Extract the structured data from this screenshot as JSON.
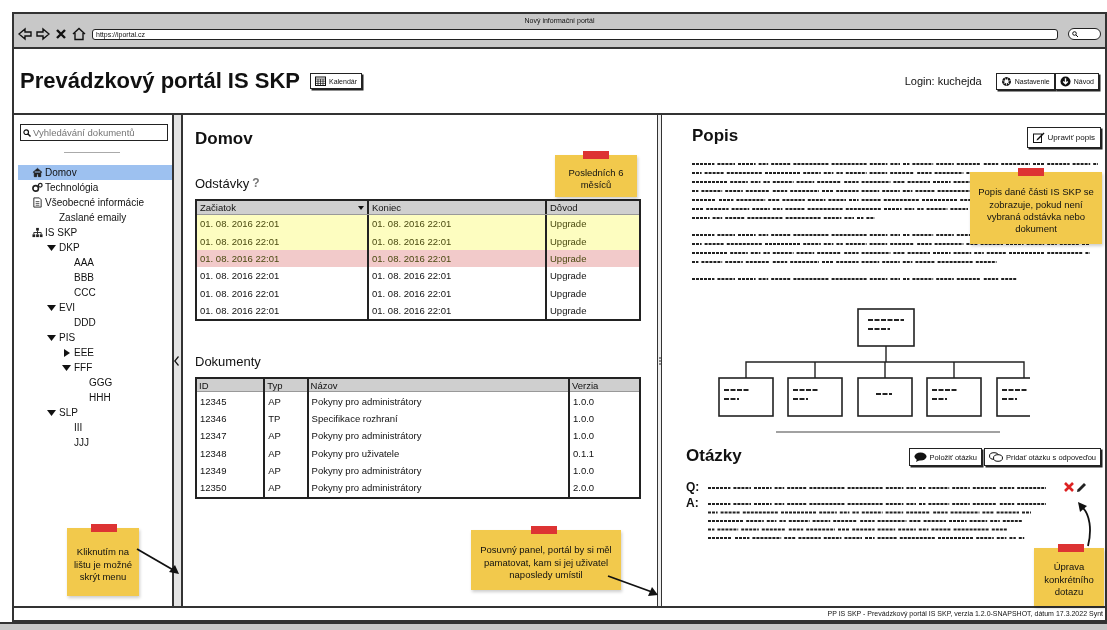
{
  "browser": {
    "title": "Nový informační portál",
    "url": "https://iportal.cz"
  },
  "header": {
    "title": "Prevádzkový portál IS SKP",
    "calendar_button": "Kalendár",
    "login": "Login: kuchejda",
    "buttons": [
      "Nastavenie",
      "Návod"
    ]
  },
  "sidebar": {
    "search_placeholder": "Vyhledávání dokumentů",
    "items": [
      {
        "label": "Domov",
        "selected": true
      },
      {
        "label": "Technológia",
        "selected": false
      },
      {
        "label": "Všeobecné informácie",
        "selected": false,
        "children": [
          {
            "label": "Zaslané emaily",
            "selected": false
          }
        ]
      },
      {
        "label": "IS SKP",
        "selected": false,
        "children": [
          {
            "label": "DKP",
            "selected": false,
            "expanded": true,
            "children": [
              {
                "label": "AAA",
                "selected": false
              },
              {
                "label": "BBB",
                "selected": false
              },
              {
                "label": "CCC",
                "selected": false
              }
            ]
          },
          {
            "label": "EVI",
            "selected": false,
            "expanded": true,
            "children": [
              {
                "label": "DDD",
                "selected": false
              }
            ]
          },
          {
            "label": "PIS",
            "selected": false,
            "expanded": true,
            "children": [
              {
                "label": "EEE",
                "selected": false,
                "expanded": false
              },
              {
                "label": "FFF",
                "selected": false,
                "expanded": true,
                "children": [
                  {
                    "label": "GGG",
                    "selected": false
                  },
                  {
                    "label": "HHH",
                    "selected": false
                  }
                ]
              }
            ]
          },
          {
            "label": "SLP",
            "selected": false,
            "expanded": true,
            "children": [
              {
                "label": "III",
                "selected": false
              },
              {
                "label": "JJJ",
                "selected": false
              }
            ]
          }
        ]
      }
    ]
  },
  "main": {
    "title": "Domov",
    "outages": {
      "title": "Odstávky",
      "help": "?",
      "columns": [
        {
          "label": "Začiatok",
          "sorted": true
        },
        {
          "label": "Koniec",
          "sorted": false
        },
        {
          "label": "Dôvod",
          "sorted": false
        }
      ],
      "rows": [
        {
          "color": "#fdfdc0",
          "cells": [
            "01. 08. 2016 22:01",
            "01. 08. 2016 22:01",
            "Upgrade"
          ]
        },
        {
          "color": "#fdfdc0",
          "cells": [
            "01. 08. 2016 22:01",
            "01. 08. 2016 22:01",
            "Upgrade"
          ]
        },
        {
          "color": "#f2caca",
          "cells": [
            "01. 08. 2016 22:01",
            "01. 08. 2016 22:01",
            "Upgrade"
          ]
        },
        {
          "cells": [
            "01. 08. 2016 22:01",
            "01. 08. 2016 22:01",
            "Upgrade"
          ]
        },
        {
          "cells": [
            "01. 08. 2016 22:01",
            "01. 08. 2016 22:01",
            "Upgrade"
          ]
        },
        {
          "cells": [
            "01. 08. 2016 22:01",
            "01. 08. 2016 22:01",
            "Upgrade"
          ]
        }
      ]
    },
    "documents": {
      "title": "Dokumenty",
      "columns": [
        "ID",
        "Typ",
        "Názov",
        "Verzia"
      ],
      "rows": [
        [
          "12345",
          "AP",
          "Pokyny pro administrátory",
          "1.0.0"
        ],
        [
          "12346",
          "TP",
          "Specifikace rozhraní",
          "1.0.0"
        ],
        [
          "12347",
          "AP",
          "Pokyny pro administrátory",
          "1.0.0"
        ],
        [
          "12348",
          "AP",
          "Pokyny pro uživatele",
          "0.1.1"
        ],
        [
          "12349",
          "AP",
          "Pokyny pro administrátory",
          "1.0.0"
        ],
        [
          "12350",
          "AP",
          "Pokyny pro administrátory",
          "2.0.0"
        ]
      ]
    }
  },
  "description": {
    "title": "Popis",
    "edit_button": "Upraviť popis"
  },
  "questions": {
    "title": "Otázky",
    "buttons": [
      "Položiť otázku",
      "Pridať otázku s odpoveďou"
    ],
    "question_label": "Q:",
    "answer_label": "A:"
  },
  "notes": [
    {
      "text": "Posledních 6 měsíců"
    },
    {
      "text": "Popis dané části IS SKP se zobrazuje, pokud není vybraná odstávka nebo dokument"
    },
    {
      "text": "Kliknutím na lištu je možné skrýt menu"
    },
    {
      "text": "Posuvný panel, portál by si měl pamatovat, kam si jej uživatel naposledy umístil"
    },
    {
      "text": "Úprava konkrétního dotazu"
    }
  ],
  "footer": "PP IS SKP - Prevádzkový portál IS SKP, verzia 1.2.0-SNAPSHOT, dátum 17.3.2022 Synt"
}
